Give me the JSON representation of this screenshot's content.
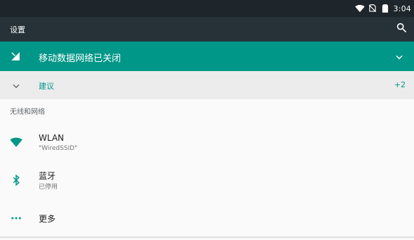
{
  "status_bar": {
    "time": "3:04",
    "icons": [
      "wifi-icon",
      "no-sim-icon",
      "battery-icon"
    ]
  },
  "app_bar": {
    "title": "设置",
    "search_icon": "search-icon"
  },
  "mobile_data_banner": {
    "text": "移动数据网络已关闭",
    "icon": "mobile-data-off-icon",
    "chevron": "chevron-down-icon"
  },
  "suggestions": {
    "label": "建议",
    "count": "+2",
    "chevron": "chevron-down-icon"
  },
  "section": {
    "title": "无线和网络"
  },
  "items": [
    {
      "icon": "wifi-icon",
      "title": "WLAN",
      "subtitle": "\"WiredSSID\""
    },
    {
      "icon": "bluetooth-icon",
      "title": "蓝牙",
      "subtitle": "已停用"
    },
    {
      "icon": "more-icon",
      "title": "更多",
      "subtitle": ""
    }
  ],
  "colors": {
    "status_bar": "#1e262b",
    "app_bar": "#263238",
    "accent": "#009688",
    "suggestions_bg": "#ececec",
    "page_bg": "#fafafa"
  }
}
